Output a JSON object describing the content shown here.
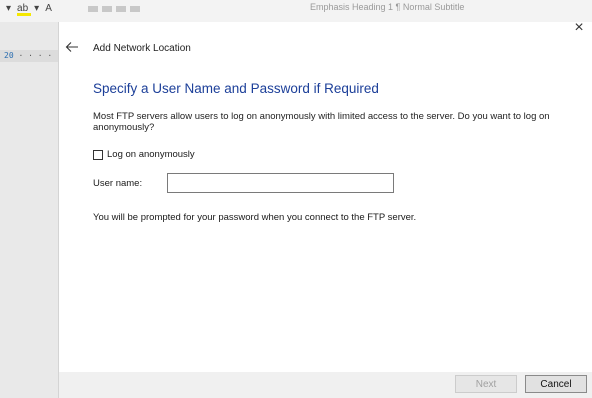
{
  "background": {
    "styles_text": "Emphasis   Heading 1   ¶ Normal   Subtitle",
    "ruler_text": "20",
    "ruler_dots": "· · · ·"
  },
  "dialog": {
    "title": "Add Network Location",
    "close_glyph": "×",
    "heading": "Specify a User Name and Password if Required",
    "description": "Most FTP servers allow users to log on anonymously with limited access to the server.  Do you want to log on anonymously?",
    "anonymous_label": "Log on anonymously",
    "anonymous_checked": false,
    "username_label": "User name:",
    "username_value": "",
    "note": "You will be prompted for your password when you connect to the FTP server.",
    "next_label": "Next",
    "cancel_label": "Cancel"
  },
  "colors": {
    "heading": "#1c3f99",
    "accent_highlight": "#f5e800"
  }
}
